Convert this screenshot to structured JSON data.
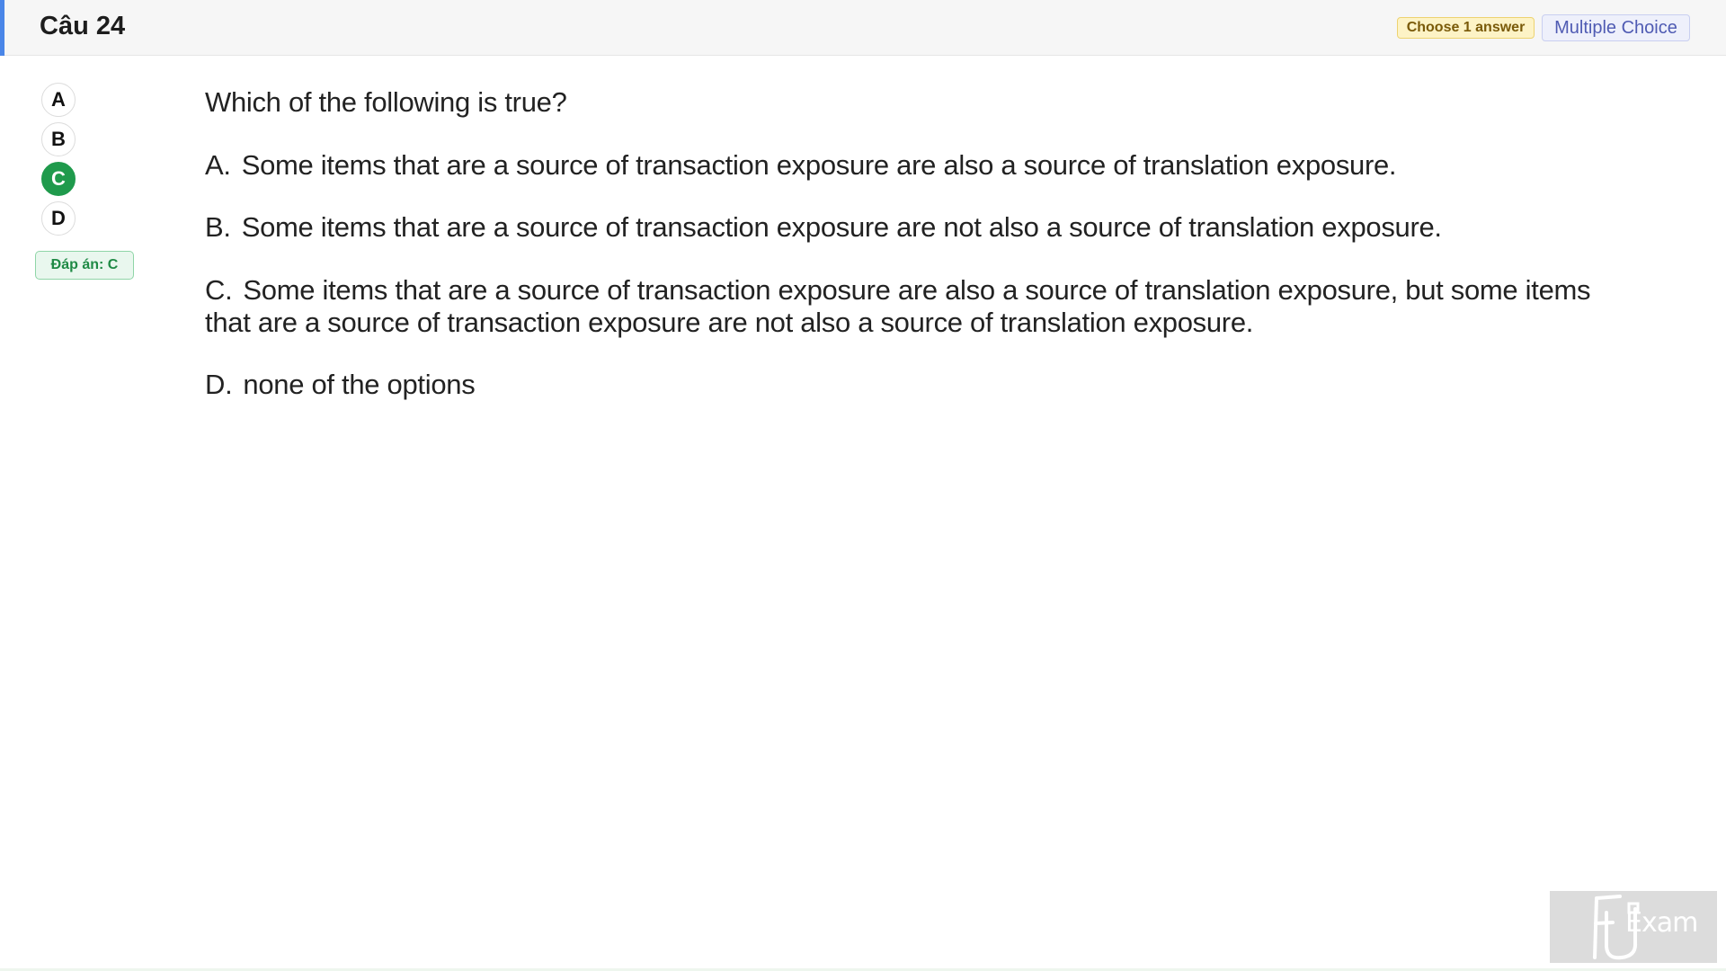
{
  "header": {
    "title": "Câu 24",
    "choose_badge": "Choose 1 answer",
    "type_badge": "Multiple Choice"
  },
  "answer_picker": {
    "options": [
      "A",
      "B",
      "C",
      "D"
    ],
    "selected": "C",
    "answer_label": "Đáp án: C"
  },
  "question": {
    "prompt": "Which of the following is true?",
    "choices": [
      {
        "letter": "A.",
        "text": "Some items that are a source of transaction exposure are also a source of translation exposure."
      },
      {
        "letter": "B.",
        "text": "Some items that are a source of transaction exposure are not also a source of translation exposure."
      },
      {
        "letter": "C.",
        "text": "Some items that are a source of transaction exposure are also a source of translation exposure, but some items that are a source of transaction exposure are not also a source of translation exposure."
      },
      {
        "letter": "D.",
        "text": "none of the options"
      }
    ]
  },
  "watermark": {
    "logo_text": "Exam",
    "accent_color": "#dcdcdc"
  },
  "colors": {
    "accent_blue": "#4a86e8",
    "selected_green": "#1f9a4c"
  }
}
